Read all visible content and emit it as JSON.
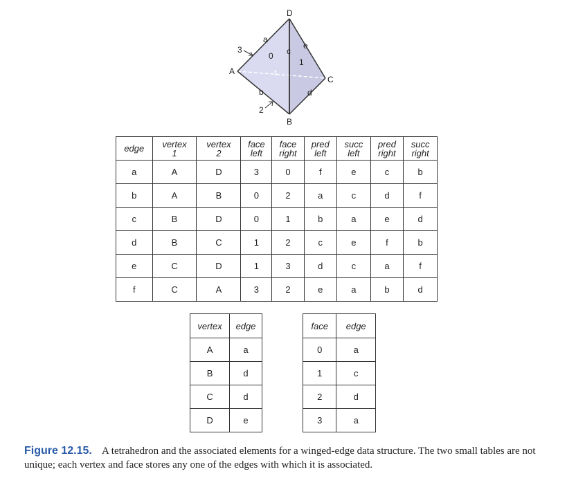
{
  "diagram": {
    "vertex_labels": [
      "D",
      "A",
      "C",
      "B"
    ],
    "edge_labels": [
      "a",
      "b",
      "c",
      "d",
      "e",
      "f"
    ],
    "face_labels": [
      "0",
      "1",
      "2",
      "3"
    ]
  },
  "main_table": {
    "headers": [
      "edge",
      "vertex 1",
      "vertex 2",
      "face left",
      "face right",
      "pred left",
      "succ left",
      "pred right",
      "succ right"
    ],
    "rows": [
      [
        "a",
        "A",
        "D",
        "3",
        "0",
        "f",
        "e",
        "c",
        "b"
      ],
      [
        "b",
        "A",
        "B",
        "0",
        "2",
        "a",
        "c",
        "d",
        "f"
      ],
      [
        "c",
        "B",
        "D",
        "0",
        "1",
        "b",
        "a",
        "e",
        "d"
      ],
      [
        "d",
        "B",
        "C",
        "1",
        "2",
        "c",
        "e",
        "f",
        "b"
      ],
      [
        "e",
        "C",
        "D",
        "1",
        "3",
        "d",
        "c",
        "a",
        "f"
      ],
      [
        "f",
        "C",
        "A",
        "3",
        "2",
        "e",
        "a",
        "b",
        "d"
      ]
    ]
  },
  "vertex_table": {
    "headers": [
      "vertex",
      "edge"
    ],
    "rows": [
      [
        "A",
        "a"
      ],
      [
        "B",
        "d"
      ],
      [
        "C",
        "d"
      ],
      [
        "D",
        "e"
      ]
    ]
  },
  "face_table": {
    "headers": [
      "face",
      "edge"
    ],
    "rows": [
      [
        "0",
        "a"
      ],
      [
        "1",
        "c"
      ],
      [
        "2",
        "d"
      ],
      [
        "3",
        "a"
      ]
    ]
  },
  "caption": {
    "label": "Figure 12.15.",
    "text": "A tetrahedron and the associated elements for a winged-edge data structure. The two small tables are not unique; each vertex and face stores any one of the edges with which it is associated."
  },
  "colors": {
    "face_fill": "#d9d9ee",
    "face_fill_dark": "#c6c6e0",
    "caption_label": "#2a5ba8",
    "stroke": "#333333"
  }
}
